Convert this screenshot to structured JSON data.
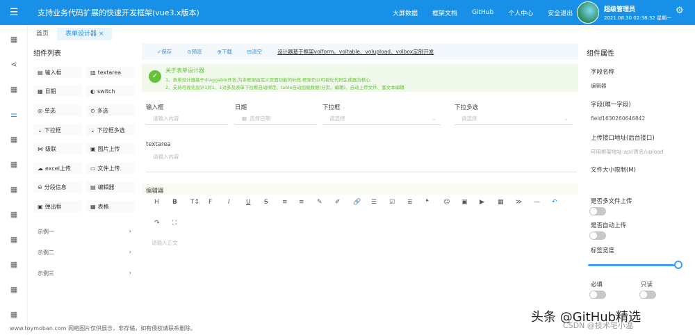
{
  "header": {
    "title": "支持业务代码扩展的快速开发框架(vue3.x版本)",
    "nav": [
      "大屏数据",
      "框架文档",
      "GitHub",
      "个人中心",
      "安全退出"
    ],
    "user_name": "超级管理员",
    "user_time": "2021.08.30 02:38:32 星期一"
  },
  "tabs": [
    {
      "label": "首页"
    },
    {
      "label": "表单设计器"
    }
  ],
  "tab_close": "×",
  "left_panel": {
    "title": "组件列表",
    "components": [
      {
        "label": "输入框",
        "icon": "▤"
      },
      {
        "label": "textarea",
        "icon": "▥"
      },
      {
        "label": "日期",
        "icon": "▦"
      },
      {
        "label": "switch",
        "icon": "◐"
      },
      {
        "label": "单选",
        "icon": "◎"
      },
      {
        "label": "多选",
        "icon": "⊙"
      },
      {
        "label": "下拉框",
        "icon": "⌄"
      },
      {
        "label": "下拉框多选",
        "icon": "⌄"
      },
      {
        "label": "级联",
        "icon": "⋈"
      },
      {
        "label": "图片上传",
        "icon": "▣"
      },
      {
        "label": "excel上传",
        "icon": "☁"
      },
      {
        "label": "文件上传",
        "icon": "▭"
      },
      {
        "label": "分段信息",
        "icon": "⊝"
      },
      {
        "label": "编辑器",
        "icon": "▤"
      },
      {
        "label": "弹出框",
        "icon": "▣"
      },
      {
        "label": "表格",
        "icon": "▦"
      }
    ],
    "examples": [
      {
        "label": "示例一",
        "chevron": "›"
      },
      {
        "label": "示例二",
        "chevron": "›"
      },
      {
        "label": "示例三",
        "chevron": "›"
      }
    ]
  },
  "toolbar": {
    "save": "✓保存",
    "preview": "⊙预览",
    "download": "⊕下载",
    "clear": "⊟清空",
    "link": "设计器基于框架volform、voltable、volupload、volbox定制开发"
  },
  "tip": {
    "title": "关于表单设计器",
    "line1": "1、表单设计器基于draggable开发,为本框架自定义页面功能的补充,框架仍以可视化代码生成器为核心",
    "line2": "2、支持可视化设计1对1、1对多及表单下拉框自动绑定、table自动加载数据(分页、编辑)、自动上传文件、富文本编辑"
  },
  "form": {
    "input_label": "输入框",
    "input_placeholder": "请输入内容",
    "date_label": "日期",
    "date_placeholder": "选择日期",
    "select_label": "下拉框",
    "select_placeholder": "请选择",
    "multi_label": "下拉多选",
    "multi_placeholder": "请选择",
    "textarea_label": "textarea",
    "textarea_placeholder": "请输入内容",
    "editor_label": "编辑器",
    "editor_placeholder": "请输入正文"
  },
  "editor_tools": [
    "H",
    "B",
    "T↕",
    "F",
    "I",
    "U",
    "S",
    "≡",
    "≡",
    "✎",
    "✐",
    "🔗",
    "☰",
    "☑",
    "≣",
    "❝",
    "☺",
    "▣",
    "▶",
    "▦",
    "≫",
    "—",
    "↶",
    "↷",
    "⛶"
  ],
  "right_panel": {
    "title": "组件属性",
    "field_name_label": "字段名称",
    "field_name_value": "编辑器",
    "field_id_label": "字段(唯一字段)",
    "field_id_value": "field1630260646842",
    "upload_url_label": "上传接口地址(后台接口)",
    "upload_url_placeholder": "可用框架地址:api/表名/upload",
    "file_size_label": "文件大小限制(M)",
    "multi_file_label": "是否多文件上传",
    "auto_upload_label": "是否自动上传",
    "label_width_label": "标签宽度",
    "required_label": "必填",
    "readonly_label": "只读"
  },
  "watermarks": {
    "bottom": "www.toymoban.com 网络图片仅供展示，非存储，如有侵权请联系删除。",
    "brand": "头条 @GitHub精选",
    "csdn": "CSDN @技术宅小温"
  }
}
